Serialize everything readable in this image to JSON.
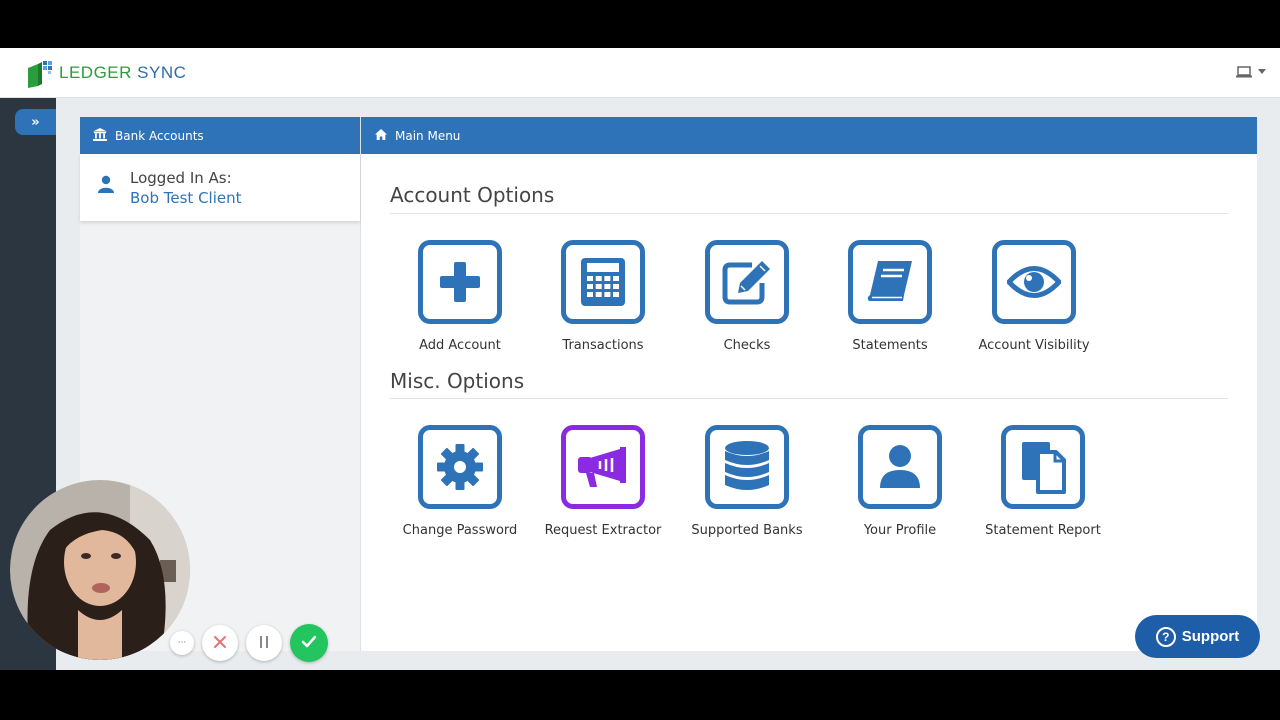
{
  "header": {
    "logo_text_left": "LEDGER",
    "logo_text_right": "SYNC",
    "device_icon": "laptop-icon",
    "dropdown_icon": "caret-down-icon"
  },
  "rail": {
    "toggle_icon": "double-chevron-right-icon",
    "toggle_glyph": "»"
  },
  "left_panel": {
    "title": "Bank Accounts",
    "title_icon": "bank-icon",
    "logged_in_label": "Logged In As:",
    "user_name": "Bob Test Client"
  },
  "main_panel": {
    "title": "Main Menu",
    "title_icon": "home-icon",
    "sections": [
      {
        "title": "Account Options",
        "items": [
          {
            "label": "Add Account",
            "icon": "plus-icon"
          },
          {
            "label": "Transactions",
            "icon": "calculator-icon"
          },
          {
            "label": "Checks",
            "icon": "edit-icon"
          },
          {
            "label": "Statements",
            "icon": "book-icon"
          },
          {
            "label": "Account Visibility",
            "icon": "eye-icon"
          }
        ]
      },
      {
        "title": "Misc. Options",
        "items": [
          {
            "label": "Change Password",
            "icon": "gear-icon"
          },
          {
            "label": "Request Extractor",
            "icon": "megaphone-icon"
          },
          {
            "label": "Supported Banks",
            "icon": "database-icon"
          },
          {
            "label": "Your Profile",
            "icon": "user-icon"
          },
          {
            "label": "Statement Report",
            "icon": "documents-icon"
          }
        ]
      }
    ]
  },
  "support": {
    "label": "Support",
    "icon": "question-circle-icon"
  },
  "recording": {
    "more_glyph": "···",
    "colors": {
      "accent": "#2e73b8",
      "purple": "#8a2be2",
      "green": "#22c55e",
      "cancel": "#e57373"
    }
  }
}
